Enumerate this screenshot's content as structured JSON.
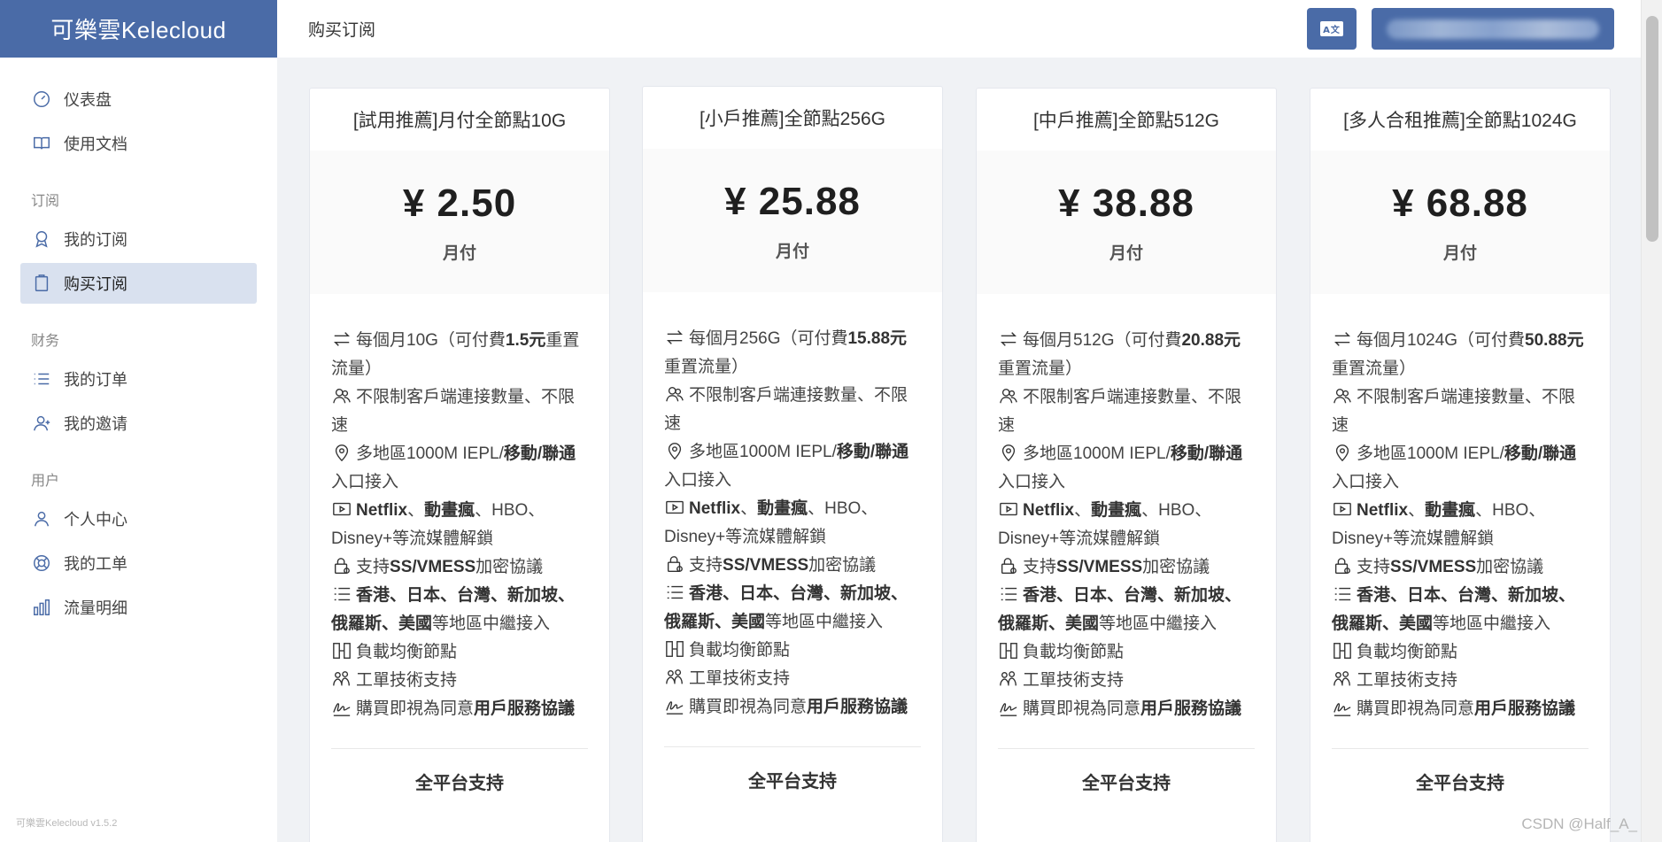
{
  "brand": "可樂雲Kelecloud",
  "version": "可樂雲Kelecloud v1.5.2",
  "header": {
    "page_title": "购买订阅",
    "lang_icon": "translate-icon"
  },
  "nav": {
    "top": [
      {
        "label": "仪表盘",
        "icon": "dashboard-icon"
      },
      {
        "label": "使用文档",
        "icon": "book-icon"
      }
    ],
    "groups": [
      {
        "title": "订阅",
        "items": [
          {
            "label": "我的订阅",
            "icon": "award-icon"
          },
          {
            "label": "购买订阅",
            "icon": "clipboard-icon",
            "active": true
          }
        ]
      },
      {
        "title": "财务",
        "items": [
          {
            "label": "我的订单",
            "icon": "list-icon"
          },
          {
            "label": "我的邀请",
            "icon": "user-plus-icon"
          }
        ]
      },
      {
        "title": "用户",
        "items": [
          {
            "label": "个人中心",
            "icon": "user-icon"
          },
          {
            "label": "我的工单",
            "icon": "lifebuoy-icon"
          },
          {
            "label": "流量明细",
            "icon": "bar-chart-icon"
          }
        ]
      }
    ]
  },
  "plans": [
    {
      "name": "[試用推薦]月付全節點10G",
      "price": "¥ 2.50",
      "period": "月付",
      "f1a": "每個月10G（可付費",
      "f1b": "1.5元",
      "f1c": "重置流量）"
    },
    {
      "name": "[小戶推薦]全節點256G",
      "price": "¥ 25.88",
      "period": "月付",
      "f1a": "每個月256G（可付費",
      "f1b": "15.88元",
      "f1c": "重置流量）"
    },
    {
      "name": "[中戶推薦]全節點512G",
      "price": "¥ 38.88",
      "period": "月付",
      "f1a": "每個月512G（可付費",
      "f1b": "20.88元",
      "f1c": "重置流量）"
    },
    {
      "name": "[多人合租推薦]全節點1024G",
      "price": "¥ 68.88",
      "period": "月付",
      "f1a": "每個月1024G（可付費",
      "f1b": "50.88元",
      "f1c": "重置流量）"
    }
  ],
  "features": {
    "f2": "不限制客戶端連接數量、不限速",
    "f3a": "多地區1000M IEPL/",
    "f3b": "移動/聯通",
    "f3c": "入口接入",
    "f4a": "Netflix",
    "f4b": "、",
    "f4c": "動畫瘋",
    "f4d": "、HBO、Disney+等流媒體解鎖",
    "f5a": "支持",
    "f5b": "SS/VMESS",
    "f5c": "加密協議",
    "f6a": "香港、日本、台灣、新加坡、俄羅斯、美國",
    "f6b": "等地區中繼接入",
    "f7": "負載均衡節點",
    "f8": "工單技術支持",
    "f9a": "購買即視為同意",
    "f9b": "用戶服務協議",
    "platform": "全平台支持"
  },
  "watermark": "CSDN @Half_A_"
}
